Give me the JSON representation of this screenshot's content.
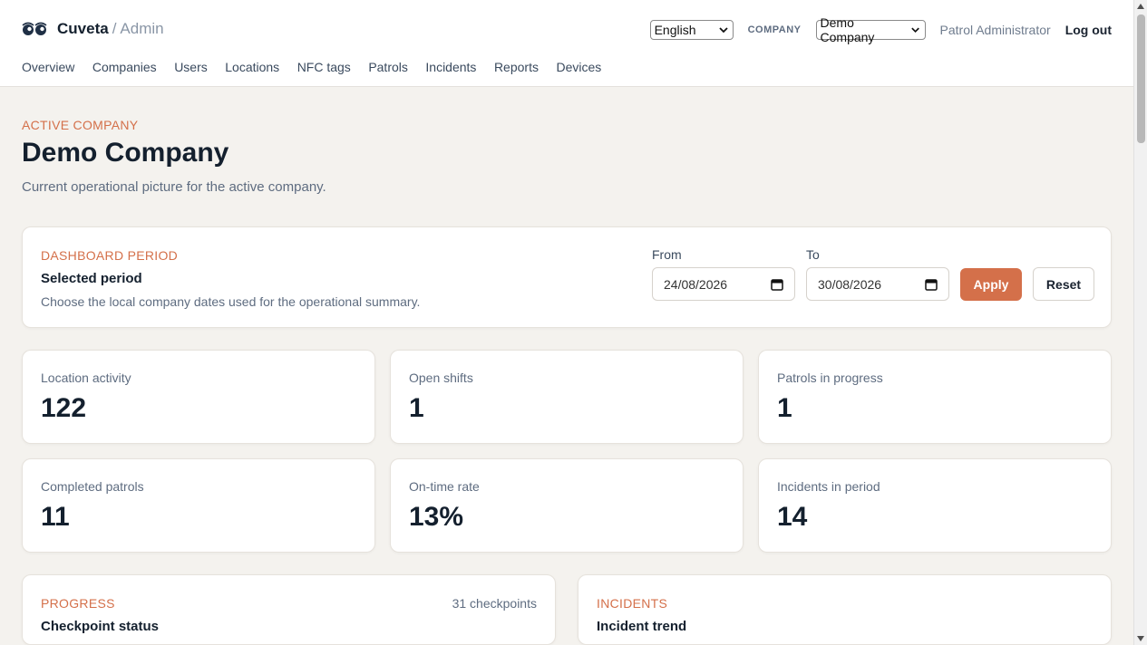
{
  "brand": {
    "name": "Cuveta",
    "separator": "/",
    "area": "Admin"
  },
  "header": {
    "language": "English",
    "company_label": "COMPANY",
    "company_select": "Demo Company",
    "user": "Patrol Administrator",
    "logout": "Log out"
  },
  "nav": [
    "Overview",
    "Companies",
    "Users",
    "Locations",
    "NFC tags",
    "Patrols",
    "Incidents",
    "Reports",
    "Devices"
  ],
  "page": {
    "eyebrow": "ACTIVE COMPANY",
    "title": "Demo Company",
    "subtitle": "Current operational picture for the active company."
  },
  "period": {
    "eyebrow": "DASHBOARD PERIOD",
    "title": "Selected period",
    "description": "Choose the local company dates used for the operational summary.",
    "from_label": "From",
    "from_value": "24/08/2026",
    "to_label": "To",
    "to_value": "30/08/2026",
    "apply": "Apply",
    "reset": "Reset"
  },
  "stats": [
    {
      "label": "Location activity",
      "value": "122"
    },
    {
      "label": "Open shifts",
      "value": "1"
    },
    {
      "label": "Patrols in progress",
      "value": "1"
    },
    {
      "label": "Completed patrols",
      "value": "11"
    },
    {
      "label": "On-time rate",
      "value": "13%"
    },
    {
      "label": "Incidents in period",
      "value": "14"
    }
  ],
  "panels": [
    {
      "eyebrow": "PROGRESS",
      "title": "Checkpoint status",
      "count": "31 checkpoints"
    },
    {
      "eyebrow": "INCIDENTS",
      "title": "Incident trend",
      "count": ""
    }
  ],
  "colors": {
    "accent": "#d4704a",
    "text": "#14202e",
    "muted": "#5e6c80",
    "background": "#f4f2ee"
  }
}
